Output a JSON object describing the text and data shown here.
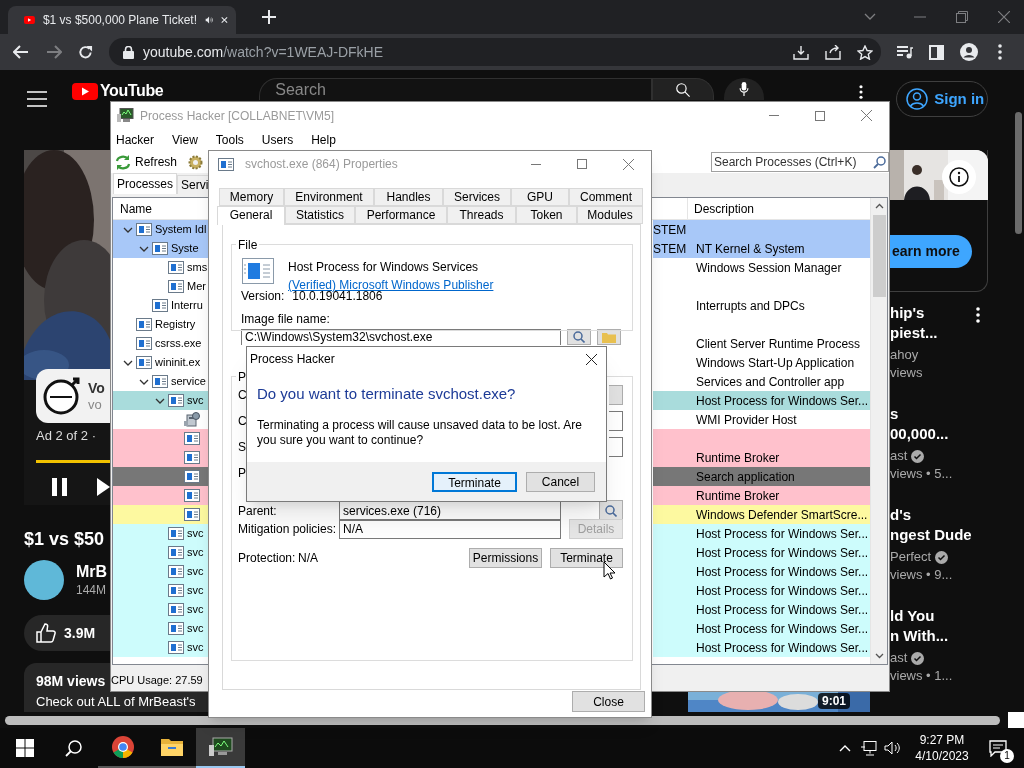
{
  "browser": {
    "tab_title": "$1 vs $500,000 Plane Ticket!",
    "url_host": "youtube.com",
    "url_path": "/watch?v=1WEAJ-DFkHE"
  },
  "youtube": {
    "logo": "YouTube",
    "search_placeholder": "Search",
    "sign_in": "Sign in",
    "ad": {
      "title": "Vo",
      "subtitle": "vo",
      "counter": "Ad 2 of 2 ·"
    },
    "video": {
      "title": "$1 vs $50",
      "channel": "MrB",
      "subscribers": "144M",
      "likes": "3.9M",
      "views": "98M views",
      "description": "Check out ALL of MrBeast's"
    },
    "learn_more": "earn more",
    "related": [
      {
        "title_lines": [
          "hip's",
          "piest..."
        ],
        "channel": "ahoy",
        "meta": "views",
        "verified": false,
        "menu_shown": true
      },
      {
        "title_lines": [
          "s",
          "00,000..."
        ],
        "channel": "ast",
        "meta": "views • 5...",
        "verified": true,
        "menu_shown": false
      },
      {
        "title_lines": [
          "d's",
          "ngest Dude"
        ],
        "channel": "Perfect",
        "meta": "views • 9...",
        "verified": true,
        "menu_shown": false
      },
      {
        "title_lines": [
          "ld You",
          "n With..."
        ],
        "channel": "ast",
        "meta": "views • 1...",
        "verified": true,
        "menu_shown": false
      }
    ],
    "duration": "9:01"
  },
  "process_hacker": {
    "title": "Process Hacker [COLLABNET\\VM5]",
    "menu": [
      "Hacker",
      "View",
      "Tools",
      "Users",
      "Help"
    ],
    "refresh": "Refresh",
    "search_placeholder": "Search Processes (Ctrl+K)",
    "tabs": [
      {
        "label": "Processes",
        "selected": true
      },
      {
        "label": "Servi",
        "selected": false
      }
    ],
    "columns": {
      "name": "Name",
      "description": "Description"
    },
    "processes": [
      {
        "name": "System Idl",
        "user": "STEM",
        "color": "#a8c8f8",
        "kind": "process",
        "expanded": true,
        "children": [
          {
            "name": "Syste",
            "user": "STEM",
            "description": "NT Kernel & System",
            "color": "#a8c8f8",
            "kind": "process",
            "expanded": true,
            "children": [
              {
                "name": "sms",
                "description": "Windows Session Manager",
                "color": "#ffffff",
                "kind": "process"
              },
              {
                "name": "Mer",
                "color": "#ffffff",
                "kind": "process"
              }
            ]
          },
          {
            "name": "Interru",
            "description": "Interrupts and DPCs",
            "color": "#ffffff",
            "kind": "process"
          }
        ]
      },
      {
        "name": "Registry",
        "color": "#ffffff",
        "kind": "process"
      },
      {
        "name": "csrss.exe",
        "description": "Client Server Runtime Process",
        "color": "#ffffff",
        "kind": "process"
      },
      {
        "name": "wininit.ex",
        "description": "Windows Start-Up Application",
        "color": "#ffffff",
        "kind": "process",
        "expanded": true,
        "children": [
          {
            "name": "service",
            "description": "Services and Controller app",
            "color": "#ffffff",
            "kind": "process",
            "expanded": true,
            "children": [
              {
                "name": "svc",
                "description": "Host Process for Windows Ser...",
                "color": "#a9dcdc",
                "kind": "process",
                "expanded": true,
                "children": [
                  {
                    "description": "WMI Provider Host",
                    "color": "#ffffff",
                    "kind": "wmi"
                  },
                  {
                    "color": "#ffc1cc",
                    "kind": "process"
                  },
                  {
                    "description": "Runtime Broker",
                    "color": "#ffc1cc",
                    "kind": "process"
                  },
                  {
                    "description": "Search application",
                    "color": "#777777",
                    "kind": "process"
                  },
                  {
                    "description": "Runtime Broker",
                    "color": "#ffc1cc",
                    "kind": "process"
                  },
                  {
                    "description": "Windows Defender SmartScre...",
                    "color": "#fdf9a0",
                    "kind": "process"
                  }
                ]
              },
              {
                "name": "svc",
                "description": "Host Process for Windows Ser...",
                "color": "#cdfcfc",
                "kind": "process"
              },
              {
                "name": "svc",
                "description": "Host Process for Windows Ser...",
                "color": "#cdfcfc",
                "kind": "process"
              },
              {
                "name": "svc",
                "description": "Host Process for Windows Ser...",
                "color": "#cdfcfc",
                "kind": "process"
              },
              {
                "name": "svc",
                "description": "Host Process for Windows Ser...",
                "color": "#cdfcfc",
                "kind": "process"
              },
              {
                "name": "svc",
                "description": "Host Process for Windows Ser...",
                "color": "#cdfcfc",
                "kind": "process"
              },
              {
                "name": "svc",
                "description": "Host Process for Windows Ser...",
                "color": "#cdfcfc",
                "kind": "process"
              },
              {
                "name": "svc",
                "description": "Host Process for Windows Ser...",
                "color": "#cdfcfc",
                "kind": "process"
              }
            ]
          }
        ]
      }
    ],
    "status": "CPU Usage: 27.59"
  },
  "properties": {
    "title": "svchost.exe (864) Properties",
    "tab_rows": [
      [
        {
          "label": "Memory",
          "selected": false
        },
        {
          "label": "Environment",
          "selected": false
        },
        {
          "label": "Handles",
          "selected": false
        },
        {
          "label": "Services",
          "selected": false
        },
        {
          "label": "GPU",
          "selected": false
        },
        {
          "label": "Comment",
          "selected": false
        }
      ],
      [
        {
          "label": "General",
          "selected": true
        },
        {
          "label": "Statistics",
          "selected": false
        },
        {
          "label": "Performance",
          "selected": false
        },
        {
          "label": "Threads",
          "selected": false
        },
        {
          "label": "Token",
          "selected": false
        },
        {
          "label": "Modules",
          "selected": false
        }
      ]
    ],
    "file": {
      "legend": "File",
      "description": "Host Process for Windows Services",
      "publisher": "(Verified) Microsoft Windows Publisher",
      "version_label": "Version:",
      "version": "10.0.19041.1806",
      "image_label": "Image file name:",
      "image_path": "C:\\Windows\\System32\\svchost.exe"
    },
    "process": {
      "legend": "P",
      "fragments": [
        {
          "label": "C",
          "kind": "field_button"
        },
        {
          "label": "C",
          "kind": "field"
        },
        {
          "label": "S",
          "kind": "field"
        },
        {
          "label": "P",
          "kind": "text"
        }
      ],
      "parent_label": "Parent:",
      "parent": "services.exe (716)",
      "mitigation_label": "Mitigation policies:",
      "mitigation": "N/A",
      "details": {
        "label": "Details",
        "disabled": true
      },
      "protection_label": "Protection:",
      "protection": "N/A",
      "buttons": [
        "Permissions",
        "Terminate"
      ]
    },
    "close": "Close"
  },
  "dialog": {
    "title": "Process Hacker",
    "heading": "Do you want to terminate svchost.exe?",
    "message": "Terminating a process will cause unsaved data to be lost. Are you sure you want to continue?",
    "buttons": [
      {
        "label": "Terminate",
        "default": true
      },
      {
        "label": "Cancel",
        "default": false
      }
    ]
  },
  "taskbar": {
    "apps": [
      {
        "kind": "browser",
        "active": false
      },
      {
        "kind": "folder",
        "active": false
      },
      {
        "kind": "monitor",
        "active": true
      }
    ],
    "time": "9:27 PM",
    "date": "4/10/2023",
    "notifications": "1"
  }
}
